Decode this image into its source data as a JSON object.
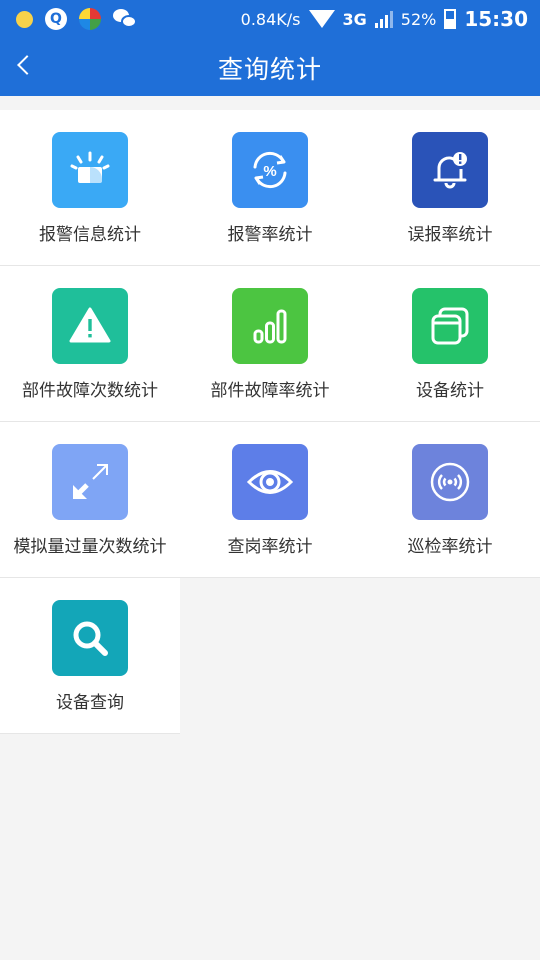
{
  "status_bar": {
    "network_speed": "0.84K/s",
    "network_type": "3G",
    "battery": "52%",
    "time": "15:30"
  },
  "header": {
    "title": "查询统计"
  },
  "items": [
    {
      "label": "报警信息统计",
      "icon": "alarm-light-icon",
      "color": "#3aa9f5"
    },
    {
      "label": "报警率统计",
      "icon": "percent-cycle-icon",
      "color": "#3a8ff0"
    },
    {
      "label": "误报率统计",
      "icon": "bell-alert-icon",
      "color": "#2a53b8"
    },
    {
      "label": "部件故障次数统计",
      "icon": "warning-triangle-icon",
      "color": "#1fbf9a"
    },
    {
      "label": "部件故障率统计",
      "icon": "bar-signal-icon",
      "color": "#4cc541"
    },
    {
      "label": "设备统计",
      "icon": "window-stack-icon",
      "color": "#25c26a"
    },
    {
      "label": "模拟量过量次数统计",
      "icon": "expand-arrows-icon",
      "color": "#7fa5f5"
    },
    {
      "label": "查岗率统计",
      "icon": "eye-icon",
      "color": "#5d7ee8"
    },
    {
      "label": "巡检率统计",
      "icon": "radar-wave-icon",
      "color": "#6d83dc"
    },
    {
      "label": "设备查询",
      "icon": "magnifier-icon",
      "color": "#13a6b8"
    }
  ]
}
